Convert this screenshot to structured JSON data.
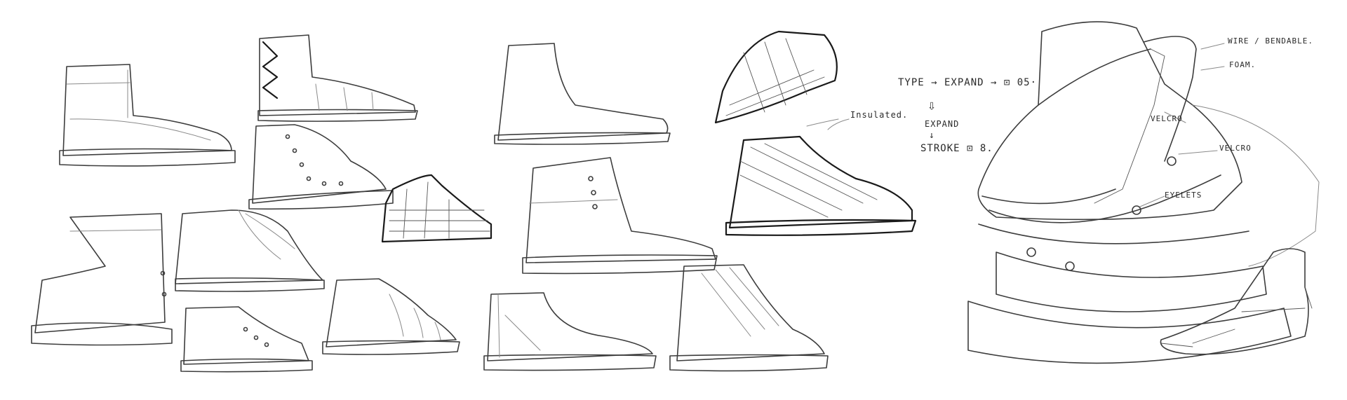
{
  "annotations": {
    "type_line": "TYPE → EXPAND → ⊡ 05·",
    "expand_arrow": "⇩",
    "expand_label": "EXPAND",
    "stroke_arrow": "↓",
    "stroke_line": "STROKE ⊡ 8.",
    "insulated": "Insulated.",
    "wire_bendable": "WIRE / BENDABLE.",
    "foam": "FOAM.",
    "velcro_a": "VELCRO",
    "velcro_b": "VELCRO",
    "eyelets": "EYELETS"
  },
  "colors": {
    "paper": "#ffffff",
    "pencil": "#3d3d3d"
  }
}
